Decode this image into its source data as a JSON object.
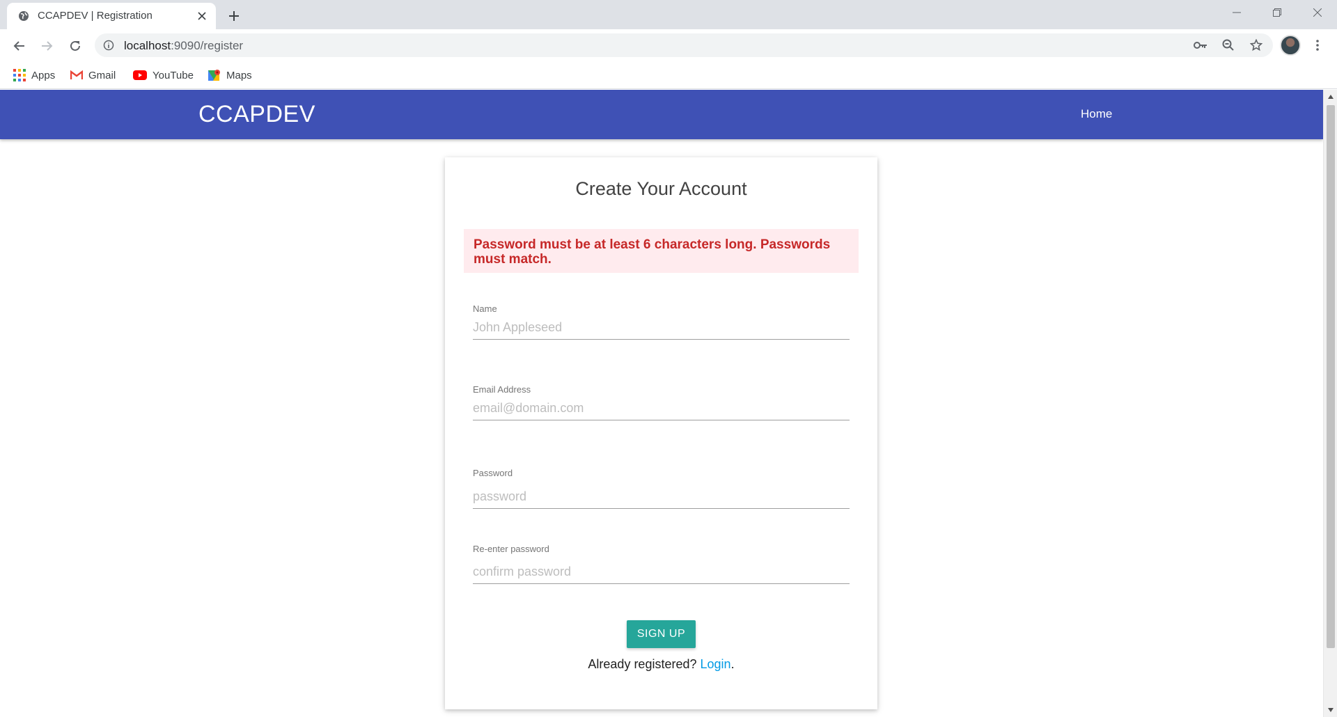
{
  "browser": {
    "tab_title": "CCAPDEV | Registration",
    "url_host": "localhost",
    "url_path": ":9090/register",
    "bookmarks": [
      {
        "label": "Apps",
        "icon": "apps-grid-icon"
      },
      {
        "label": "Gmail",
        "icon": "gmail-icon"
      },
      {
        "label": "YouTube",
        "icon": "youtube-icon"
      },
      {
        "label": "Maps",
        "icon": "maps-icon"
      }
    ]
  },
  "navbar": {
    "brand": "CCAPDEV",
    "home_label": "Home"
  },
  "form": {
    "title": "Create Your Account",
    "error_message": "Password must be at least 6 characters long. Passwords must match.",
    "fields": [
      {
        "label": "Name",
        "placeholder": "John Appleseed",
        "value": ""
      },
      {
        "label": "Email Address",
        "placeholder": "email@domain.com",
        "value": ""
      },
      {
        "label": "Password",
        "placeholder": "password",
        "value": ""
      },
      {
        "label": "Re-enter password",
        "placeholder": "confirm password",
        "value": ""
      }
    ],
    "submit_label": "SIGN UP",
    "login_prompt": "Already registered?",
    "login_link": "Login",
    "login_suffix": "."
  },
  "colors": {
    "navbar": "#3f51b5",
    "button": "#26a69a",
    "error_bg": "#ffebee",
    "error_text": "#c62828",
    "link": "#039be5"
  }
}
